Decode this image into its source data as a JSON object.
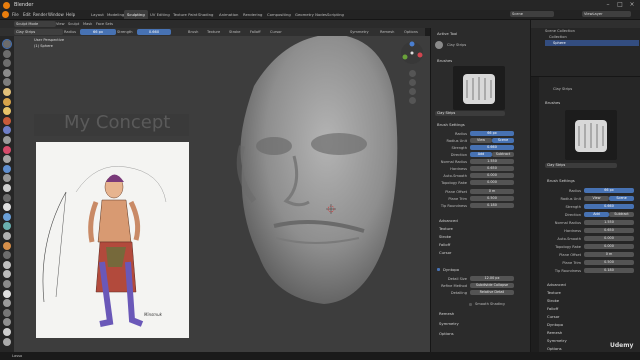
{
  "title_bar": {
    "app_title": "Blender"
  },
  "menu": [
    "File",
    "Edit",
    "Render",
    "Window",
    "Help"
  ],
  "workspace_tabs": [
    "Layout",
    "Modeling",
    "Sculpting",
    "UV Editing",
    "Texture Paint",
    "Shading",
    "Animation",
    "Rendering",
    "Compositing",
    "Geometry Nodes",
    "Scripting"
  ],
  "active_workspace": "Sculpting",
  "scene": {
    "label": "Scene",
    "view_layer": "ViewLayer"
  },
  "header": {
    "mode": "Sculpt Mode",
    "menus": [
      "View",
      "Sculpt",
      "Mask",
      "Face Sets"
    ],
    "brush": "Clay Strips",
    "radius_label": "Radius",
    "radius_value": "66 px",
    "strength_label": "Strength",
    "strength_value": "0.660",
    "dropdowns": [
      "Brush",
      "Texture",
      "Stroke",
      "Falloff",
      "Cursor"
    ],
    "symmetry": "Symmetry",
    "remesh": "Remesh",
    "options": "Options"
  },
  "viewport": {
    "perspective": "User Perspective",
    "object": "(1) Sphere",
    "concept_title": "My Concept",
    "concept_caption": "Minsmuk"
  },
  "props_panel": {
    "active_tool": "Active Tool",
    "tool_name": "Clay Strips",
    "brushes": "Brushes",
    "brush_name": "Clay Strips",
    "brush_settings": "Brush Settings",
    "rows": [
      {
        "label": "Radius",
        "value": "66 px"
      },
      {
        "label": "Radius Unit",
        "value": "View",
        "value2": "Scene"
      },
      {
        "label": "Strength",
        "value": "0.660"
      },
      {
        "label": "Direction",
        "value": "Add",
        "value2": "Subtract"
      },
      {
        "label": "Normal Radius",
        "value": "1.550"
      },
      {
        "label": "Hardness",
        "value": "0.650"
      },
      {
        "label": "Auto-Smooth",
        "value": "0.000"
      },
      {
        "label": "Topology Rake",
        "value": "0.000"
      }
    ],
    "rows2": [
      {
        "label": "Plane Offset",
        "value": "0 m"
      },
      {
        "label": "Plane Trim",
        "value": "0.500"
      },
      {
        "label": "Tip Roundness",
        "value": "0.180"
      }
    ],
    "sections": [
      "Advanced",
      "Texture",
      "Stroke",
      "Falloff",
      "Cursor"
    ],
    "dyntopo": "Dyntopo",
    "dyn_rows": [
      {
        "label": "Detail Size",
        "value": "12.00 px"
      },
      {
        "label": "Refine Method",
        "value": "Subdivide Collapse"
      },
      {
        "label": "Detailing",
        "value": "Relative Detail"
      }
    ],
    "smooth_shading": "Smooth Shading",
    "bottom_sections": [
      "Remesh",
      "Symmetry",
      "Options"
    ]
  },
  "outliner": {
    "scene_collection": "Scene Collection",
    "collection": "Collection",
    "sphere": "Sphere"
  },
  "right_props": {
    "tool_name": "Clay Strips",
    "brushes": "Brushes",
    "brush_name": "Clay Strips",
    "brush_settings": "Brush Settings",
    "rows": [
      {
        "label": "Radius",
        "value": "66 px"
      },
      {
        "label": "Radius Unit",
        "value": "View",
        "value2": "Scene"
      },
      {
        "label": "Strength",
        "value": "0.660"
      },
      {
        "label": "Direction",
        "value": "Add",
        "value2": "Subtract"
      },
      {
        "label": "Normal Radius",
        "value": "1.550"
      },
      {
        "label": "Hardness",
        "value": "0.650"
      },
      {
        "label": "Auto-Smooth",
        "value": "0.000"
      },
      {
        "label": "Topology Rake",
        "value": "0.000"
      },
      {
        "label": "Plane Offset",
        "value": "0 m"
      },
      {
        "label": "Plane Trim",
        "value": "0.500"
      },
      {
        "label": "Tip Roundness",
        "value": "0.180"
      }
    ],
    "sections": [
      "Advanced",
      "Texture",
      "Stroke",
      "Falloff",
      "Cursor",
      "Dyntopo",
      "Remesh",
      "Symmetry",
      "Options"
    ]
  },
  "watermark": "Udemy",
  "status_left": "Lasso"
}
